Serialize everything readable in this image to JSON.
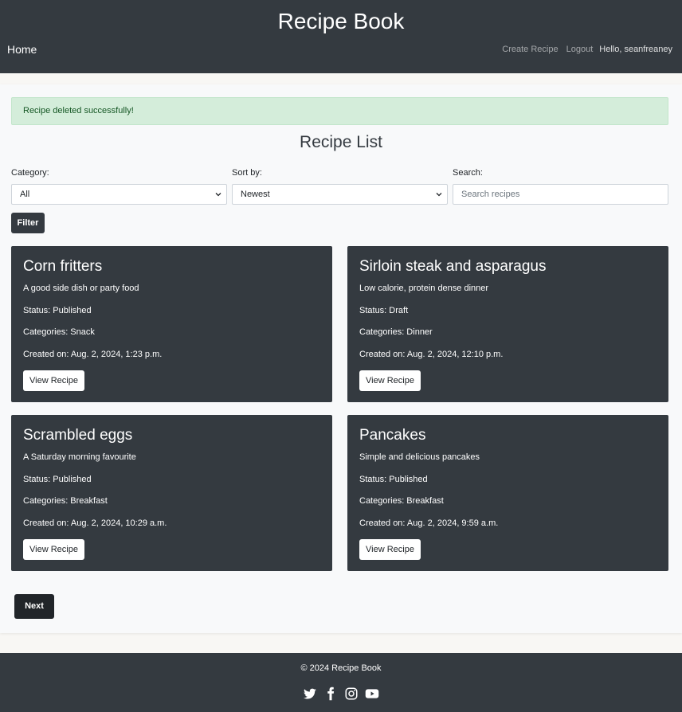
{
  "header": {
    "site_title": "Recipe Book",
    "home_link": "Home",
    "create_recipe_link": "Create Recipe",
    "logout_link": "Logout",
    "greeting": "Hello, seanfreaney"
  },
  "alert": {
    "message": "Recipe deleted successfully!"
  },
  "page_title": "Recipe List",
  "filters": {
    "category_label": "Category:",
    "category_value": "All",
    "sort_label": "Sort by:",
    "sort_value": "Newest",
    "search_label": "Search:",
    "search_placeholder": "Search recipes",
    "filter_button": "Filter"
  },
  "recipes": [
    {
      "title": "Corn fritters",
      "description": "A good side dish or party food",
      "status": "Status: Published",
      "categories": "Categories: Snack",
      "created": "Created on: Aug. 2, 2024, 1:23 p.m.",
      "button": "View Recipe"
    },
    {
      "title": "Sirloin steak and asparagus",
      "description": "Low calorie, protein dense dinner",
      "status": "Status: Draft",
      "categories": "Categories: Dinner",
      "created": "Created on: Aug. 2, 2024, 12:10 p.m.",
      "button": "View Recipe"
    },
    {
      "title": "Scrambled eggs",
      "description": "A Saturday morning favourite",
      "status": "Status: Published",
      "categories": "Categories: Breakfast",
      "created": "Created on: Aug. 2, 2024, 10:29 a.m.",
      "button": "View Recipe"
    },
    {
      "title": "Pancakes",
      "description": "Simple and delicious pancakes",
      "status": "Status: Published",
      "categories": "Categories: Breakfast",
      "created": "Created on: Aug. 2, 2024, 9:59 a.m.",
      "button": "View Recipe"
    }
  ],
  "pagination": {
    "next_button": "Next"
  },
  "footer": {
    "copyright": "© 2024 Recipe Book",
    "social_icons": [
      "twitter-icon",
      "facebook-icon",
      "instagram-icon",
      "youtube-icon"
    ]
  },
  "colors": {
    "dark": "#343a40",
    "alert_bg": "#d4edda",
    "alert_text": "#155724",
    "page_bg": "#f8f9fa"
  }
}
